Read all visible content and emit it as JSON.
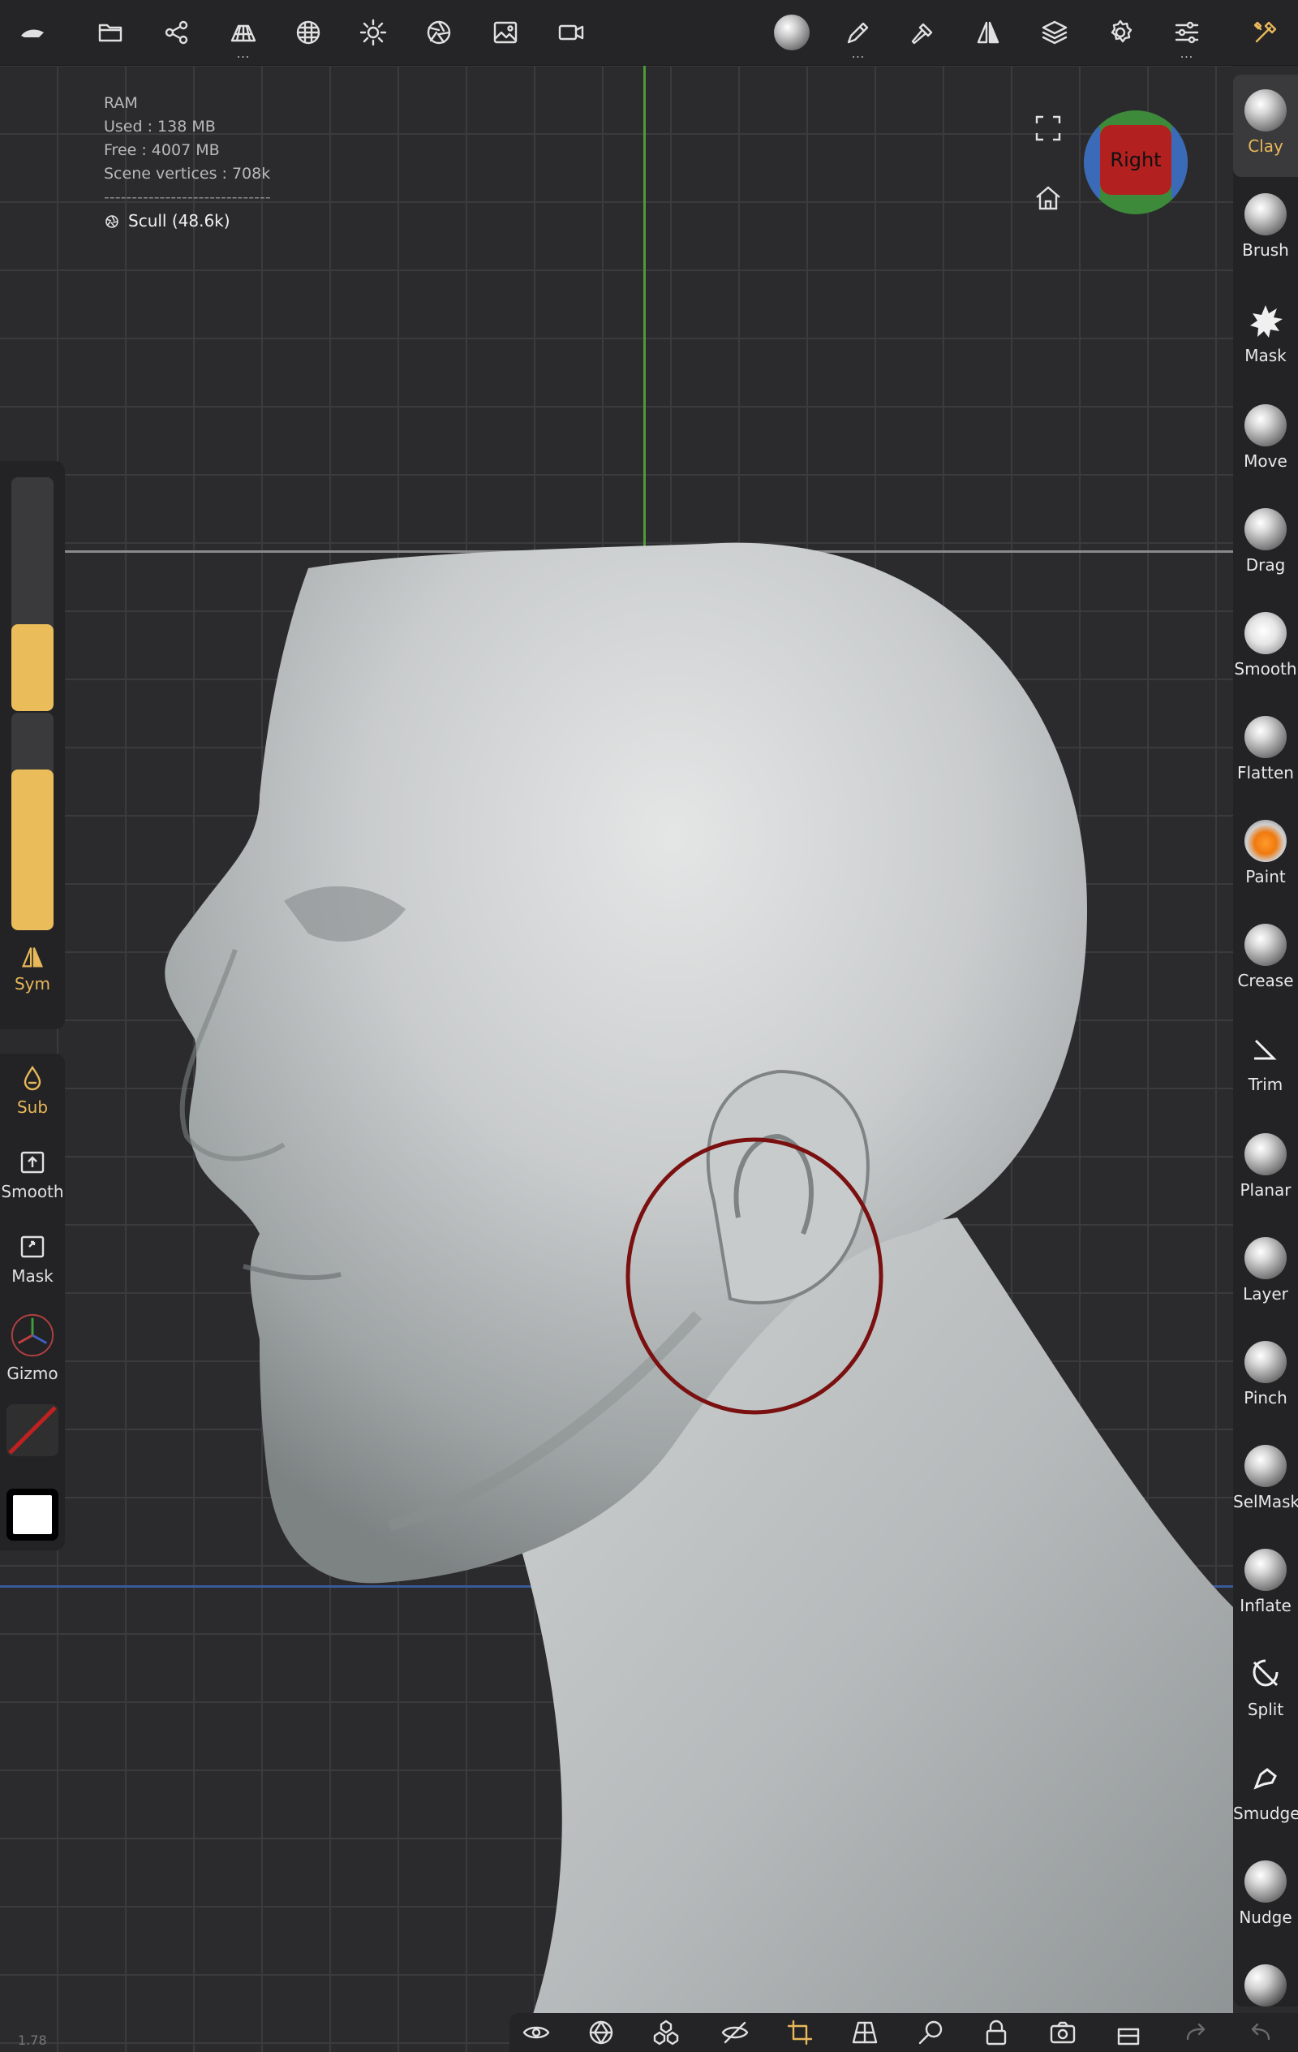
{
  "top_toolbar": {
    "icons": [
      "nomad-logo-icon",
      "folder-icon",
      "share-icon",
      "topology-icon",
      "material-icon",
      "light-icon",
      "camera-aperture-icon",
      "image-icon",
      "video-icon",
      "sphere-icon",
      "pencil-icon",
      "hammer-icon",
      "symmetry-icon",
      "layers-icon",
      "settings-icon",
      "sliders-icon",
      "tools-icon"
    ]
  },
  "scene_info": {
    "ram_label": "RAM",
    "used": "Used : 138 MB",
    "free": "Free : 4007 MB",
    "vertices": "Scene vertices : 708k",
    "separator": "------------------------------",
    "object": "Scull (48.6k)"
  },
  "view_cube": {
    "face_label": "Right"
  },
  "left_panel": {
    "radius_level": 0.37,
    "intensity_level": 0.74,
    "sym_label": "Sym",
    "sub_label": "Sub",
    "smooth_label": "Smooth",
    "mask_label": "Mask",
    "gizmo_label": "Gizmo"
  },
  "right_tools": [
    {
      "label": "Clay",
      "active": true
    },
    {
      "label": "Brush"
    },
    {
      "label": "Mask"
    },
    {
      "label": "Move"
    },
    {
      "label": "Drag"
    },
    {
      "label": "Smooth"
    },
    {
      "label": "Flatten"
    },
    {
      "label": "Paint"
    },
    {
      "label": "Crease"
    },
    {
      "label": "Trim"
    },
    {
      "label": "Planar"
    },
    {
      "label": "Layer"
    },
    {
      "label": "Pinch"
    },
    {
      "label": "SelMask"
    },
    {
      "label": "Inflate"
    },
    {
      "label": "Split"
    },
    {
      "label": "Smudge"
    },
    {
      "label": "Nudge"
    }
  ],
  "colors": {
    "accent": "#e8b85a",
    "brush_cursor": "#7a1010",
    "cube_face": "#b22020"
  },
  "version": "1.78"
}
